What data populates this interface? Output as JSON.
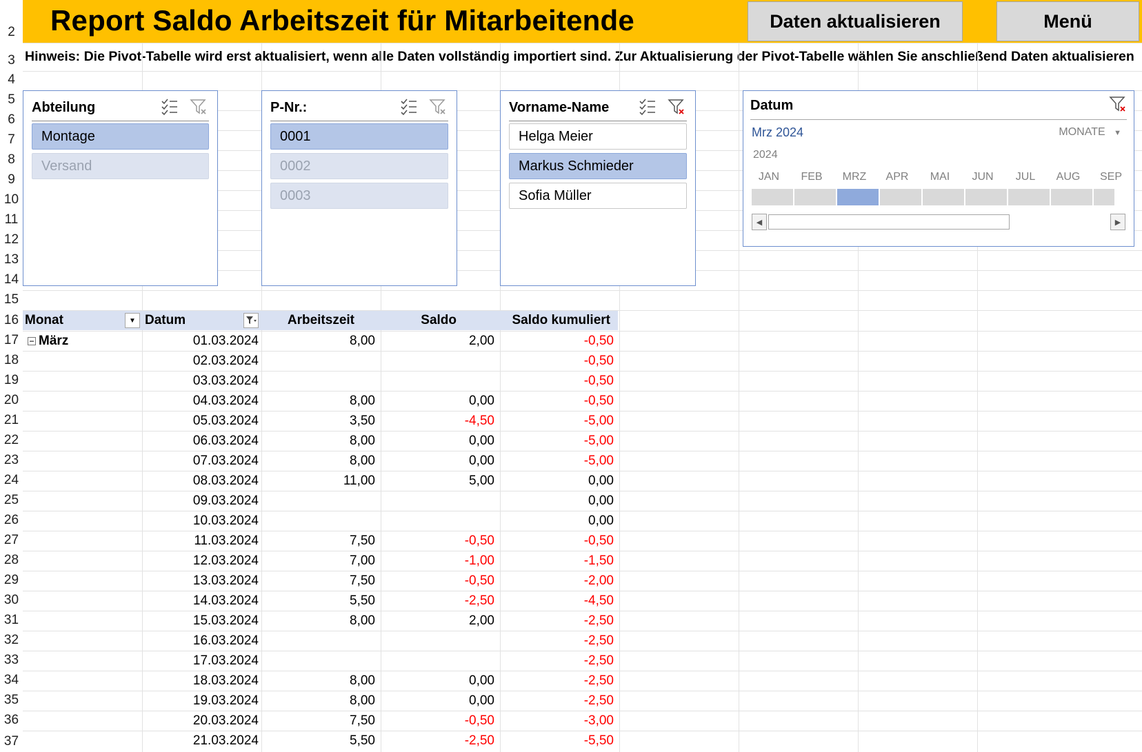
{
  "title": "Report Saldo Arbeitszeit für Mitarbeitende",
  "buttons": {
    "refresh": "Daten aktualisieren",
    "menu": "Menü"
  },
  "hint": "Hinweis: Die Pivot-Tabelle wird erst aktualisiert, wenn alle Daten vollständig importiert sind. Zur Aktualisierung der Pivot-Tabelle wählen Sie anschließend Daten aktualisieren",
  "row_numbers": [
    "2",
    "3",
    "4",
    "5",
    "6",
    "7",
    "8",
    "9",
    "10",
    "11",
    "12",
    "13",
    "14",
    "15",
    "16",
    "17",
    "18",
    "19",
    "20",
    "21",
    "22",
    "23",
    "24",
    "25",
    "26",
    "27",
    "28",
    "29",
    "30",
    "31",
    "32",
    "33",
    "34",
    "35",
    "36",
    "37"
  ],
  "slicers": {
    "abteilung": {
      "title": "Abteilung",
      "items": [
        {
          "label": "Montage",
          "state": "selected"
        },
        {
          "label": "Versand",
          "state": "dim"
        }
      ]
    },
    "pnr": {
      "title": "P-Nr.:",
      "items": [
        {
          "label": "0001",
          "state": "selected"
        },
        {
          "label": "0002",
          "state": "dim"
        },
        {
          "label": "0003",
          "state": "dim"
        }
      ]
    },
    "name": {
      "title": "Vorname-Name",
      "items": [
        {
          "label": "Helga Meier",
          "state": "plain"
        },
        {
          "label": "Markus Schmieder",
          "state": "selected"
        },
        {
          "label": "Sofia Müller",
          "state": "plain"
        }
      ]
    }
  },
  "timeline": {
    "title": "Datum",
    "period": "Mrz 2024",
    "level": "MONATE",
    "year": "2024",
    "months": [
      "JAN",
      "FEB",
      "MRZ",
      "APR",
      "MAI",
      "JUN",
      "JUL",
      "AUG",
      "SEP"
    ],
    "selected_month": "MRZ"
  },
  "pivot": {
    "headers": {
      "monat": "Monat",
      "datum": "Datum",
      "arbeitszeit": "Arbeitszeit",
      "saldo": "Saldo",
      "kumuliert": "Saldo kumuliert"
    },
    "group_label": "März",
    "rows": [
      {
        "datum": "01.03.2024",
        "arbeitszeit": "8,00",
        "saldo": "2,00",
        "kumuliert": "-0,50"
      },
      {
        "datum": "02.03.2024",
        "arbeitszeit": "",
        "saldo": "",
        "kumuliert": "-0,50"
      },
      {
        "datum": "03.03.2024",
        "arbeitszeit": "",
        "saldo": "",
        "kumuliert": "-0,50"
      },
      {
        "datum": "04.03.2024",
        "arbeitszeit": "8,00",
        "saldo": "0,00",
        "kumuliert": "-0,50"
      },
      {
        "datum": "05.03.2024",
        "arbeitszeit": "3,50",
        "saldo": "-4,50",
        "kumuliert": "-5,00"
      },
      {
        "datum": "06.03.2024",
        "arbeitszeit": "8,00",
        "saldo": "0,00",
        "kumuliert": "-5,00"
      },
      {
        "datum": "07.03.2024",
        "arbeitszeit": "8,00",
        "saldo": "0,00",
        "kumuliert": "-5,00"
      },
      {
        "datum": "08.03.2024",
        "arbeitszeit": "11,00",
        "saldo": "5,00",
        "kumuliert": "0,00"
      },
      {
        "datum": "09.03.2024",
        "arbeitszeit": "",
        "saldo": "",
        "kumuliert": "0,00"
      },
      {
        "datum": "10.03.2024",
        "arbeitszeit": "",
        "saldo": "",
        "kumuliert": "0,00"
      },
      {
        "datum": "11.03.2024",
        "arbeitszeit": "7,50",
        "saldo": "-0,50",
        "kumuliert": "-0,50"
      },
      {
        "datum": "12.03.2024",
        "arbeitszeit": "7,00",
        "saldo": "-1,00",
        "kumuliert": "-1,50"
      },
      {
        "datum": "13.03.2024",
        "arbeitszeit": "7,50",
        "saldo": "-0,50",
        "kumuliert": "-2,00"
      },
      {
        "datum": "14.03.2024",
        "arbeitszeit": "5,50",
        "saldo": "-2,50",
        "kumuliert": "-4,50"
      },
      {
        "datum": "15.03.2024",
        "arbeitszeit": "8,00",
        "saldo": "2,00",
        "kumuliert": "-2,50"
      },
      {
        "datum": "16.03.2024",
        "arbeitszeit": "",
        "saldo": "",
        "kumuliert": "-2,50"
      },
      {
        "datum": "17.03.2024",
        "arbeitszeit": "",
        "saldo": "",
        "kumuliert": "-2,50"
      },
      {
        "datum": "18.03.2024",
        "arbeitszeit": "8,00",
        "saldo": "0,00",
        "kumuliert": "-2,50"
      },
      {
        "datum": "19.03.2024",
        "arbeitszeit": "8,00",
        "saldo": "0,00",
        "kumuliert": "-2,50"
      },
      {
        "datum": "20.03.2024",
        "arbeitszeit": "7,50",
        "saldo": "-0,50",
        "kumuliert": "-3,00"
      },
      {
        "datum": "21.03.2024",
        "arbeitszeit": "5,50",
        "saldo": "-2,50",
        "kumuliert": "-5,50"
      }
    ]
  },
  "colors": {
    "title_bar": "#ffc000",
    "slicer_selected": "#b4c6e7",
    "pivot_header": "#d9e1f2",
    "negative": "#ff0000",
    "timeline_text": "#2f5597"
  }
}
